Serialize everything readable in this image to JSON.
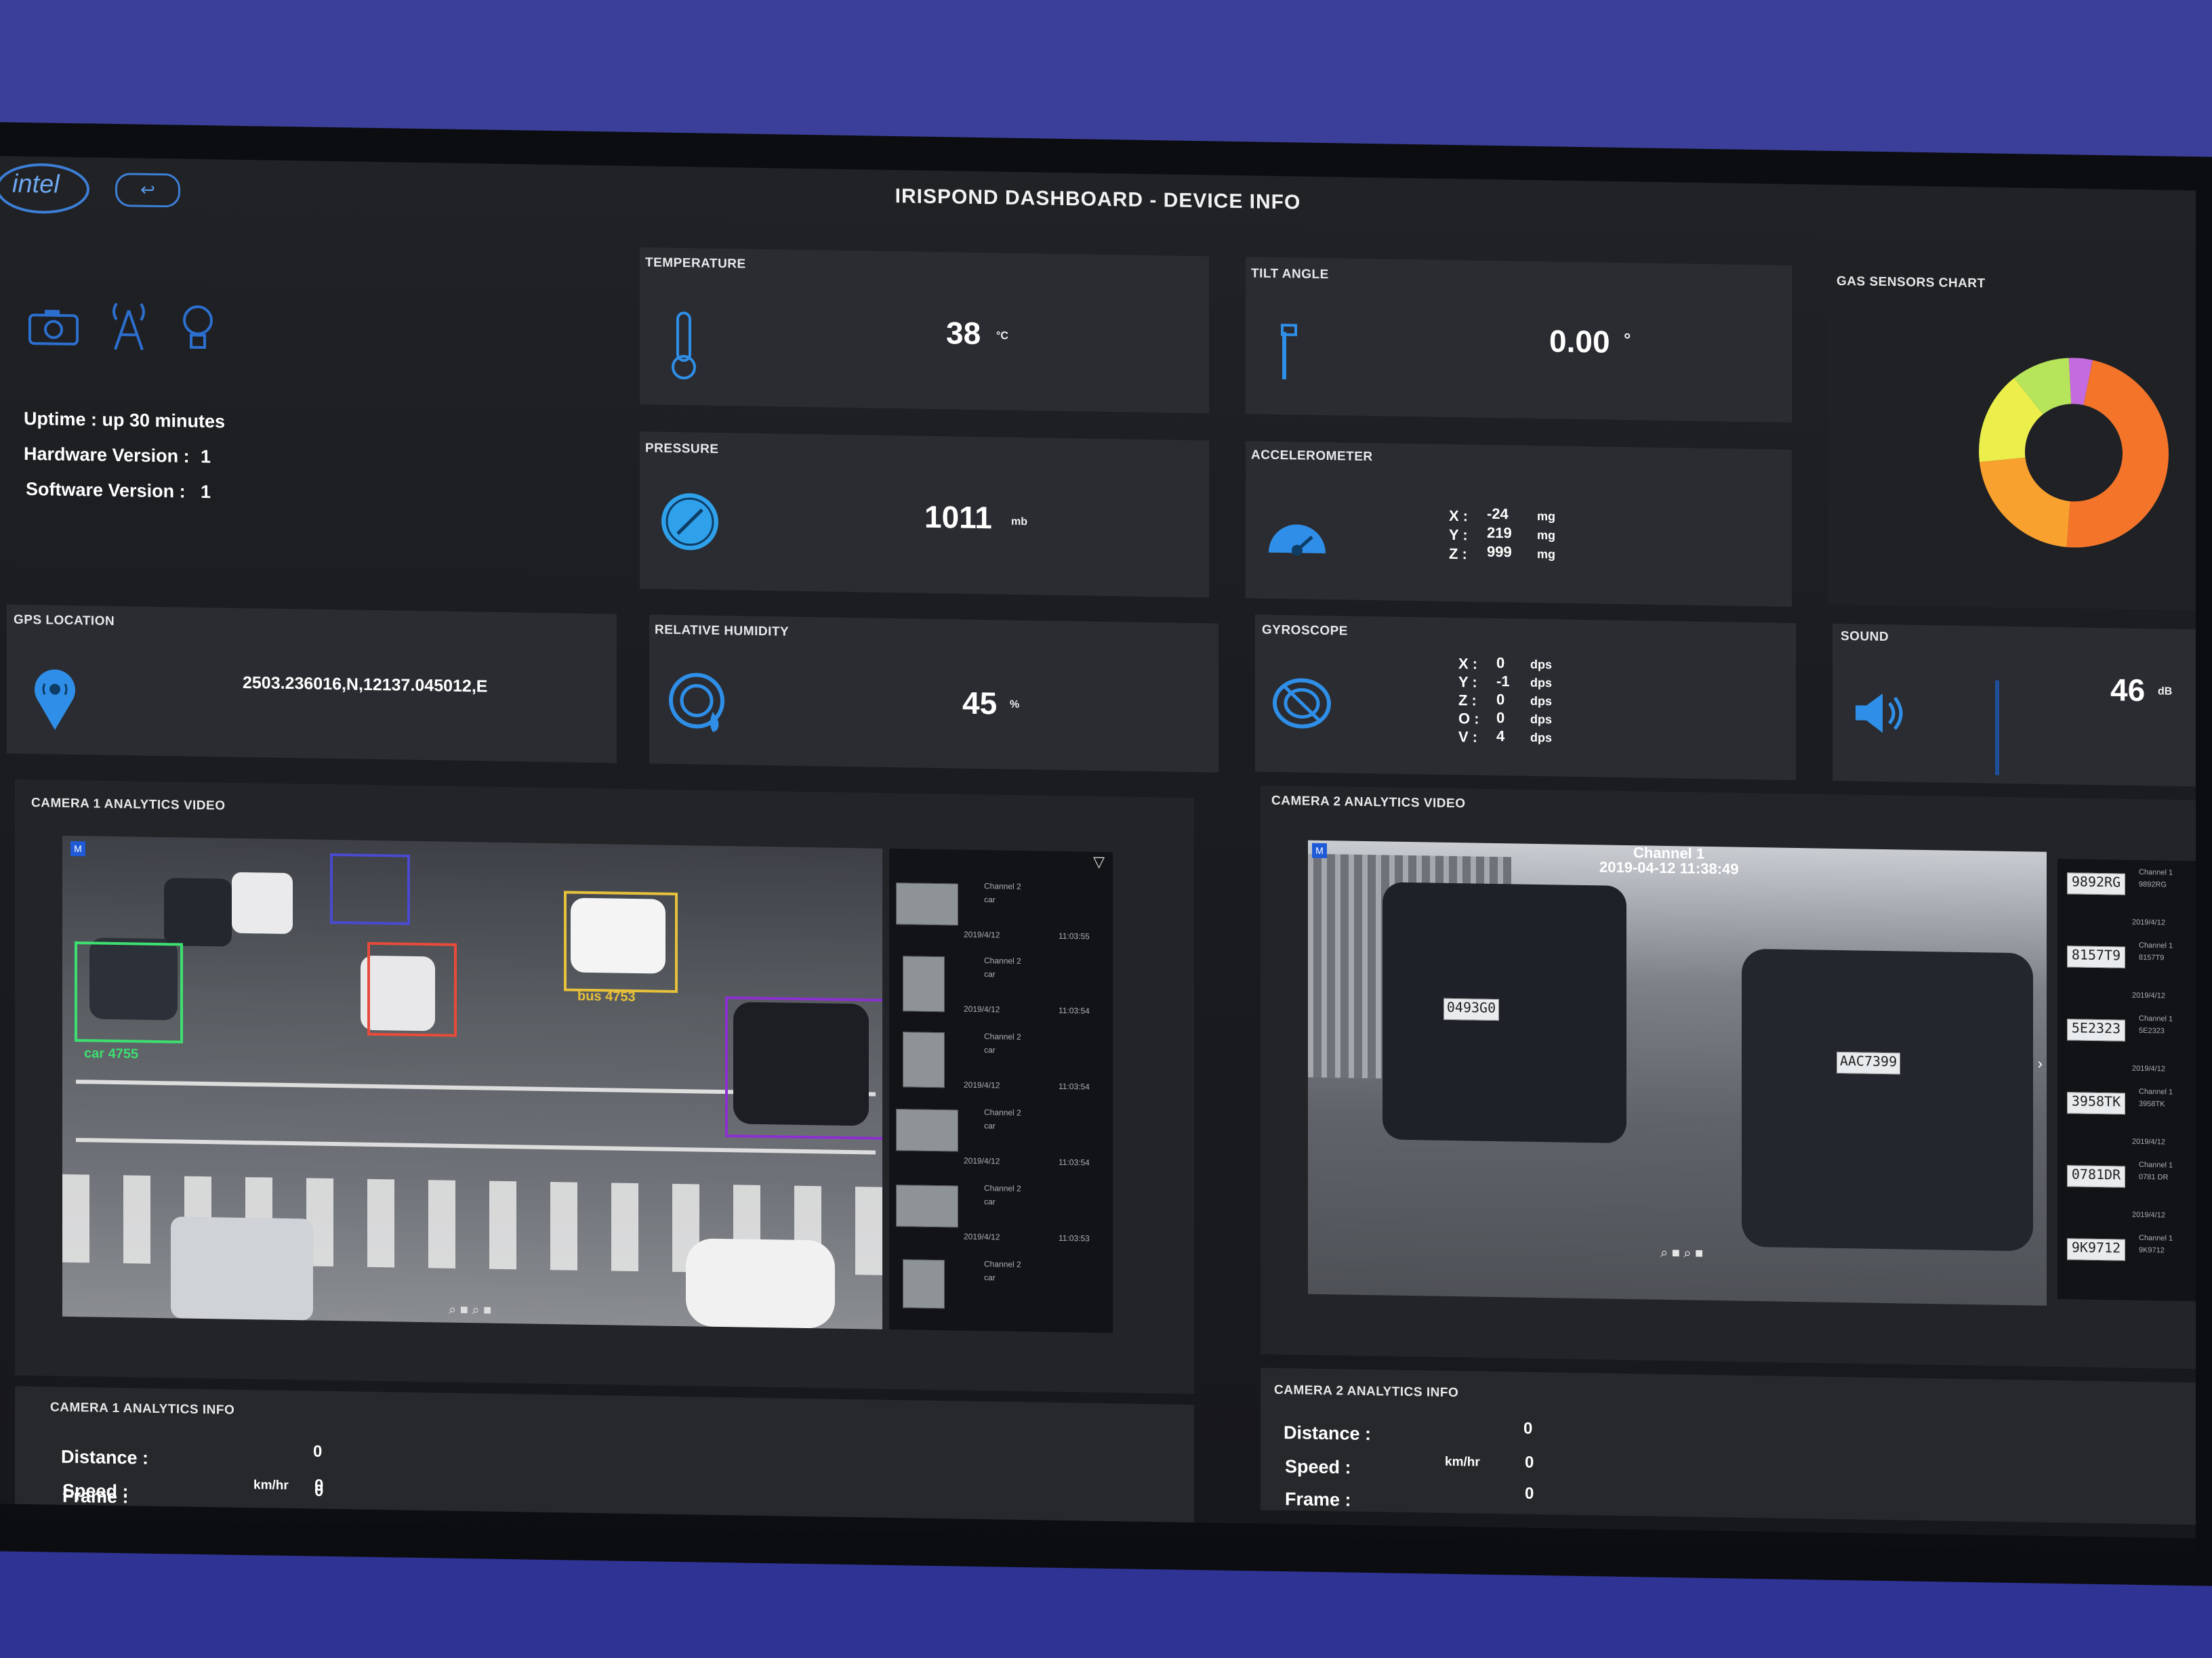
{
  "dashboard": {
    "title": "IRISPOND DASHBOARD - DEVICE INFO",
    "logo": "intel"
  },
  "device": {
    "uptime": "Uptime : up 30 minutes",
    "hardware_label": "Hardware Version :",
    "hardware_value": "1",
    "software_label": "Software Version :",
    "software_value": "1"
  },
  "gps": {
    "title": "GPS LOCATION",
    "value": "2503.236016,N,12137.045012,E"
  },
  "temperature": {
    "title": "TEMPERATURE",
    "value": "38",
    "unit": "°C"
  },
  "pressure": {
    "title": "PRESSURE",
    "value": "1011",
    "unit": "mb"
  },
  "humidity": {
    "title": "RELATIVE HUMIDITY",
    "value": "45",
    "unit": "%"
  },
  "tilt": {
    "title": "TILT ANGLE",
    "value": "0.00",
    "unit": "°"
  },
  "accelerometer": {
    "title": "ACCELEROMETER",
    "rows": [
      {
        "axis": "X :",
        "value": "-24",
        "unit": "mg"
      },
      {
        "axis": "Y :",
        "value": "219",
        "unit": "mg"
      },
      {
        "axis": "Z :",
        "value": "999",
        "unit": "mg"
      }
    ]
  },
  "gyroscope": {
    "title": "GYROSCOPE",
    "rows": [
      {
        "axis": "X :",
        "value": "0",
        "unit": "dps"
      },
      {
        "axis": "Y :",
        "value": "-1",
        "unit": "dps"
      },
      {
        "axis": "Z :",
        "value": "0",
        "unit": "dps"
      },
      {
        "axis": "O :",
        "value": "0",
        "unit": "dps"
      },
      {
        "axis": "V :",
        "value": "4",
        "unit": "dps"
      }
    ]
  },
  "gas_chart": {
    "title": "GAS SENSORS CHART"
  },
  "chart_data": {
    "type": "pie",
    "title": "GAS SENSORS CHART",
    "values": [
      48,
      22,
      16,
      10,
      4
    ],
    "colors": [
      "#f4742a",
      "#f9a12e",
      "#ecee4c",
      "#b6e45a",
      "#c56be0"
    ]
  },
  "sound": {
    "title": "SOUND",
    "value": "46",
    "unit": "dB"
  },
  "camera1": {
    "title": "CAMERA 1 ANALYTICS VIDEO",
    "labels": [
      "car 4755",
      "bus 4753"
    ],
    "list": [
      {
        "channel": "Channel 2",
        "type": "car",
        "date": "2019/4/12",
        "time": "11:03:55"
      },
      {
        "channel": "Channel 2",
        "type": "car",
        "date": "2019/4/12",
        "time": "11:03:54"
      },
      {
        "channel": "Channel 2",
        "type": "car",
        "date": "2019/4/12",
        "time": "11:03:54"
      },
      {
        "channel": "Channel 2",
        "type": "car",
        "date": "2019/4/12",
        "time": "11:03:54"
      },
      {
        "channel": "Channel 2",
        "type": "car",
        "date": "2019/4/12",
        "time": "11:03:53"
      },
      {
        "channel": "Channel 2",
        "type": "car",
        "date": "",
        "time": ""
      }
    ]
  },
  "camera2": {
    "title": "CAMERA 2 ANALYTICS VIDEO",
    "channel": "Channel 1",
    "timestamp": "2019-04-12 11:38:49",
    "plates": [
      "0493G0",
      "AAC7399"
    ],
    "list": [
      {
        "plate": "9892RG",
        "channel": "Channel 1",
        "id": "9892RG",
        "date": "2019/4/12"
      },
      {
        "plate": "8157T9",
        "channel": "Channel 1",
        "id": "8157T9",
        "date": "2019/4/12"
      },
      {
        "plate": "5E2323",
        "channel": "Channel 1",
        "id": "5E2323",
        "date": "2019/4/12"
      },
      {
        "plate": "3958TK",
        "channel": "Channel 1",
        "id": "3958TK",
        "date": "2019/4/12"
      },
      {
        "plate": "0781DR",
        "channel": "Channel 1",
        "id": "0781 DR",
        "date": "2019/4/12"
      },
      {
        "plate": "9K9712",
        "channel": "Channel 1",
        "id": "9K9712",
        "date": ""
      }
    ]
  },
  "camera1_info": {
    "title": "CAMERA 1 ANALYTICS INFO",
    "distance_label": "Distance :",
    "distance_value": "0",
    "speed_label": "Speed :",
    "speed_unit": "km/hr",
    "speed_value": "0",
    "frame_label": "Frame :",
    "frame_value": "0"
  },
  "camera2_info": {
    "title": "CAMERA 2 ANALYTICS INFO",
    "distance_label": "Distance :",
    "distance_value": "0",
    "speed_label": "Speed :",
    "speed_unit": "km/hr",
    "speed_value": "0",
    "frame_label": "Frame :",
    "frame_value": "0"
  }
}
